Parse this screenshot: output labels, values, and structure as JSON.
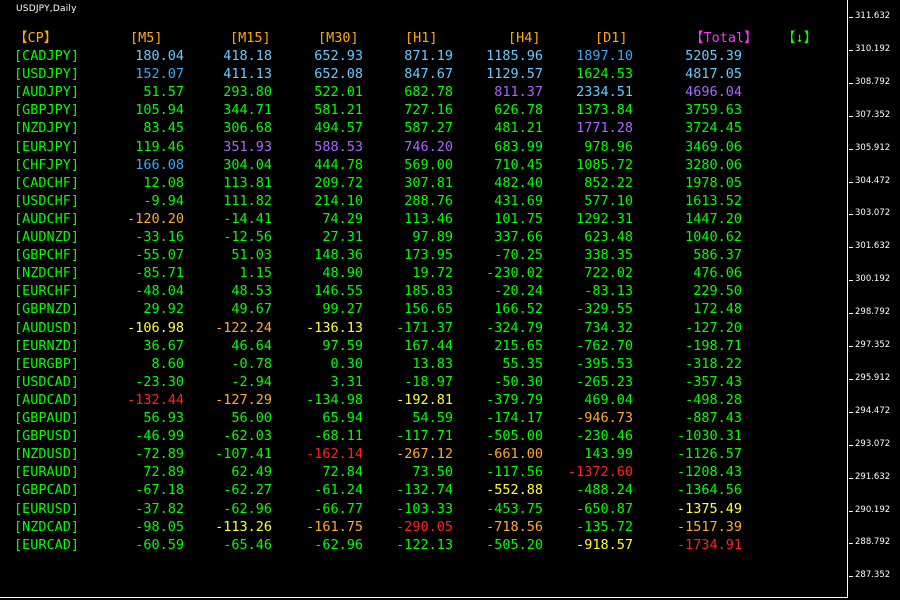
{
  "window": {
    "title": "USDJPY,Daily"
  },
  "price_axis": {
    "labels": [
      "311.632",
      "310.192",
      "308.792",
      "307.352",
      "305.912",
      "304.472",
      "303.072",
      "301.632",
      "300.192",
      "298.792",
      "297.352",
      "295.912",
      "294.472",
      "293.072",
      "291.632",
      "290.192",
      "288.792",
      "287.352"
    ]
  },
  "colors": {
    "green": "#00ff00",
    "cyan": "#33aaff",
    "lightcyan": "#66ccff",
    "purple": "#aa66ff",
    "orange": "#ffaa33",
    "yellow": "#ffff33",
    "red": "#ff2222",
    "magenta": "#ff33ff",
    "header": "#ffaa00"
  },
  "table": {
    "headers": [
      "【CP】",
      "[M5]",
      "[M15]",
      "[M30]",
      "[H1]",
      "[H4]",
      "[D1]",
      "【Total】",
      "【↓】"
    ],
    "header_colors": [
      "#ffaa00",
      "#ffaa00",
      "#ffaa00",
      "#ffaa00",
      "#ffaa00",
      "#ffaa00",
      "#ffaa00",
      "#ff33ff",
      "#00ff00"
    ],
    "rows": [
      {
        "pair": "[CADJPY]",
        "vals": [
          "180.04",
          "418.18",
          "652.93",
          "871.19",
          "1185.96",
          "1897.10",
          "5205.39"
        ],
        "colors": [
          "lightcyan",
          "lightcyan",
          "lightcyan",
          "lightcyan",
          "lightcyan",
          "cyan",
          "lightcyan"
        ]
      },
      {
        "pair": "[USDJPY]",
        "vals": [
          "152.07",
          "411.13",
          "652.08",
          "847.67",
          "1129.57",
          "1624.53",
          "4817.05"
        ],
        "colors": [
          "cyan",
          "lightcyan",
          "lightcyan",
          "lightcyan",
          "lightcyan",
          "green",
          "lightcyan"
        ]
      },
      {
        "pair": "[AUDJPY]",
        "vals": [
          "51.57",
          "293.80",
          "522.01",
          "682.78",
          "811.37",
          "2334.51",
          "4696.04"
        ],
        "colors": [
          "green",
          "green",
          "green",
          "green",
          "purple",
          "lightcyan",
          "purple"
        ]
      },
      {
        "pair": "[GBPJPY]",
        "vals": [
          "105.94",
          "344.71",
          "581.21",
          "727.16",
          "626.78",
          "1373.84",
          "3759.63"
        ],
        "colors": [
          "green",
          "green",
          "green",
          "green",
          "green",
          "green",
          "green"
        ]
      },
      {
        "pair": "[NZDJPY]",
        "vals": [
          "83.45",
          "306.68",
          "494.57",
          "587.27",
          "481.21",
          "1771.28",
          "3724.45"
        ],
        "colors": [
          "green",
          "green",
          "green",
          "green",
          "green",
          "purple",
          "green"
        ]
      },
      {
        "pair": "[EURJPY]",
        "vals": [
          "119.46",
          "351.93",
          "588.53",
          "746.20",
          "683.99",
          "978.96",
          "3469.06"
        ],
        "colors": [
          "green",
          "purple",
          "purple",
          "purple",
          "green",
          "green",
          "green"
        ]
      },
      {
        "pair": "[CHFJPY]",
        "vals": [
          "166.08",
          "304.04",
          "444.78",
          "569.00",
          "710.45",
          "1085.72",
          "3280.06"
        ],
        "colors": [
          "cyan",
          "green",
          "green",
          "green",
          "green",
          "green",
          "green"
        ]
      },
      {
        "pair": "[CADCHF]",
        "vals": [
          "12.08",
          "113.81",
          "209.72",
          "307.81",
          "482.40",
          "852.22",
          "1978.05"
        ],
        "colors": [
          "green",
          "green",
          "green",
          "green",
          "green",
          "green",
          "green"
        ]
      },
      {
        "pair": "[USDCHF]",
        "vals": [
          "-9.94",
          "111.82",
          "214.10",
          "288.76",
          "431.69",
          "577.10",
          "1613.52"
        ],
        "colors": [
          "green",
          "green",
          "green",
          "green",
          "green",
          "green",
          "green"
        ]
      },
      {
        "pair": "[AUDCHF]",
        "vals": [
          "-120.20",
          "-14.41",
          "74.29",
          "113.46",
          "101.75",
          "1292.31",
          "1447.20"
        ],
        "colors": [
          "orange",
          "green",
          "green",
          "green",
          "green",
          "green",
          "green"
        ]
      },
      {
        "pair": "[AUDNZD]",
        "vals": [
          "-33.16",
          "-12.56",
          "27.31",
          "97.89",
          "337.66",
          "623.48",
          "1040.62"
        ],
        "colors": [
          "green",
          "green",
          "green",
          "green",
          "green",
          "green",
          "green"
        ]
      },
      {
        "pair": "[GBPCHF]",
        "vals": [
          "-55.07",
          "51.03",
          "148.36",
          "173.95",
          "-70.25",
          "338.35",
          "586.37"
        ],
        "colors": [
          "green",
          "green",
          "green",
          "green",
          "green",
          "green",
          "green"
        ]
      },
      {
        "pair": "[NZDCHF]",
        "vals": [
          "-85.71",
          "1.15",
          "48.90",
          "19.72",
          "-230.02",
          "722.02",
          "476.06"
        ],
        "colors": [
          "green",
          "green",
          "green",
          "green",
          "green",
          "green",
          "green"
        ]
      },
      {
        "pair": "[EURCHF]",
        "vals": [
          "-48.04",
          "48.53",
          "146.55",
          "185.83",
          "-20.24",
          "-83.13",
          "229.50"
        ],
        "colors": [
          "green",
          "green",
          "green",
          "green",
          "green",
          "green",
          "green"
        ]
      },
      {
        "pair": "[GBPNZD]",
        "vals": [
          "29.92",
          "49.67",
          "99.27",
          "156.65",
          "166.52",
          "-329.55",
          "172.48"
        ],
        "colors": [
          "green",
          "green",
          "green",
          "green",
          "green",
          "green",
          "green"
        ]
      },
      {
        "pair": "[AUDUSD]",
        "vals": [
          "-106.98",
          "-122.24",
          "-136.13",
          "-171.37",
          "-324.79",
          "734.32",
          "-127.20"
        ],
        "colors": [
          "yellow",
          "orange",
          "yellow",
          "green",
          "green",
          "green",
          "green"
        ]
      },
      {
        "pair": "[EURNZD]",
        "vals": [
          "36.67",
          "46.64",
          "97.59",
          "167.44",
          "215.65",
          "-762.70",
          "-198.71"
        ],
        "colors": [
          "green",
          "green",
          "green",
          "green",
          "green",
          "green",
          "green"
        ]
      },
      {
        "pair": "[EURGBP]",
        "vals": [
          "8.60",
          "-0.78",
          "0.30",
          "13.83",
          "55.35",
          "-395.53",
          "-318.22"
        ],
        "colors": [
          "green",
          "green",
          "green",
          "green",
          "green",
          "green",
          "green"
        ]
      },
      {
        "pair": "[USDCAD]",
        "vals": [
          "-23.30",
          "-2.94",
          "3.31",
          "-18.97",
          "-50.30",
          "-265.23",
          "-357.43"
        ],
        "colors": [
          "green",
          "green",
          "green",
          "green",
          "green",
          "green",
          "green"
        ]
      },
      {
        "pair": "[AUDCAD]",
        "vals": [
          "-132.44",
          "-127.29",
          "-134.98",
          "-192.81",
          "-379.79",
          "469.04",
          "-498.28"
        ],
        "colors": [
          "red",
          "orange",
          "green",
          "yellow",
          "green",
          "green",
          "green"
        ]
      },
      {
        "pair": "[GBPAUD]",
        "vals": [
          "56.93",
          "56.00",
          "65.94",
          "54.59",
          "-174.17",
          "-946.73",
          "-887.43"
        ],
        "colors": [
          "green",
          "green",
          "green",
          "green",
          "green",
          "orange",
          "green"
        ]
      },
      {
        "pair": "[GBPUSD]",
        "vals": [
          "-46.99",
          "-62.03",
          "-68.11",
          "-117.71",
          "-505.00",
          "-230.46",
          "-1030.31"
        ],
        "colors": [
          "green",
          "green",
          "green",
          "green",
          "green",
          "green",
          "green"
        ]
      },
      {
        "pair": "[NZDUSD]",
        "vals": [
          "-72.89",
          "-107.41",
          "-162.14",
          "-267.12",
          "-661.00",
          "143.99",
          "-1126.57"
        ],
        "colors": [
          "green",
          "green",
          "red",
          "orange",
          "orange",
          "green",
          "green"
        ]
      },
      {
        "pair": "[EURAUD]",
        "vals": [
          "72.89",
          "62.49",
          "72.84",
          "73.50",
          "-117.56",
          "-1372.60",
          "-1208.43"
        ],
        "colors": [
          "green",
          "green",
          "green",
          "green",
          "green",
          "red",
          "green"
        ]
      },
      {
        "pair": "[GBPCAD]",
        "vals": [
          "-67.18",
          "-62.27",
          "-61.24",
          "-132.74",
          "-552.88",
          "-488.24",
          "-1364.56"
        ],
        "colors": [
          "green",
          "green",
          "green",
          "green",
          "yellow",
          "green",
          "green"
        ]
      },
      {
        "pair": "[EURUSD]",
        "vals": [
          "-37.82",
          "-62.96",
          "-66.77",
          "-103.33",
          "-453.75",
          "-650.87",
          "-1375.49"
        ],
        "colors": [
          "green",
          "green",
          "green",
          "green",
          "green",
          "green",
          "yellow"
        ]
      },
      {
        "pair": "[NZDCAD]",
        "vals": [
          "-98.05",
          "-113.26",
          "-161.75",
          "-290.05",
          "-718.56",
          "-135.72",
          "-1517.39"
        ],
        "colors": [
          "green",
          "yellow",
          "orange",
          "red",
          "orange",
          "green",
          "orange"
        ]
      },
      {
        "pair": "[EURCAD]",
        "vals": [
          "-60.59",
          "-65.46",
          "-62.96",
          "-122.13",
          "-505.20",
          "-918.57",
          "-1734.91"
        ],
        "colors": [
          "green",
          "green",
          "green",
          "green",
          "green",
          "yellow",
          "red"
        ]
      }
    ]
  }
}
